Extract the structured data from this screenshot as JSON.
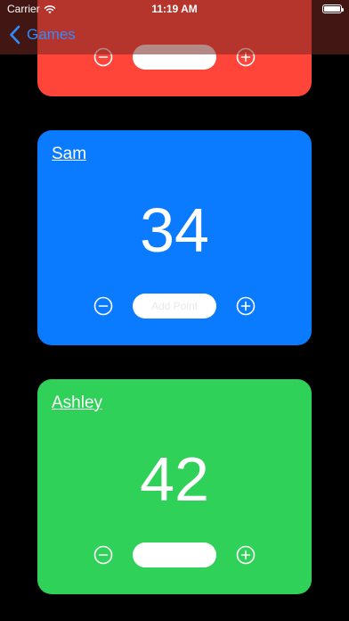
{
  "status_bar": {
    "carrier": "Carrier",
    "time": "11:19 AM",
    "icons": [
      "wifi-icon",
      "battery-icon"
    ]
  },
  "nav": {
    "back_label": "Games",
    "back_icon": "chevron-left-icon",
    "accent_color": "#2f8cff"
  },
  "players": [
    {
      "name": "",
      "score": "",
      "color": "#ff453a",
      "custom_value_placeholder": ""
    },
    {
      "name": "Sam",
      "score": "34",
      "color": "#0a7aff",
      "custom_value_placeholder": "Add Point"
    },
    {
      "name": "Ashley",
      "score": "42",
      "color": "#30d158",
      "custom_value_placeholder": ""
    }
  ],
  "controls": {
    "decrement_icon": "minus-circle-icon",
    "increment_icon": "plus-circle-icon"
  }
}
